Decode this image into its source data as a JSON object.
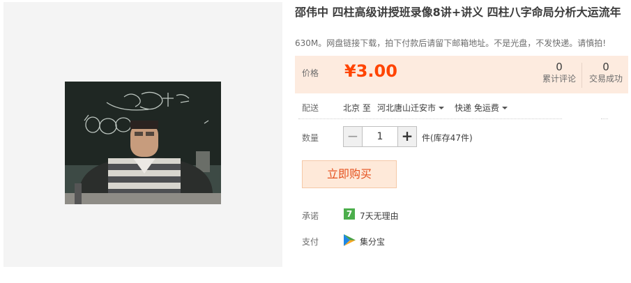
{
  "product": {
    "title": "邵伟中 四柱高级讲授班录像8讲+讲义 四柱八字命局分析大运流年",
    "subtitle": "630M。网盘链接下载，拍下付款后请留下邮箱地址。不是光盘，不发快递。请慎拍!"
  },
  "price_panel": {
    "label": "价格",
    "price": "¥3.00",
    "reviews_count": "0",
    "reviews_label": "累计评论",
    "sales_count": "0",
    "sales_label": "交易成功"
  },
  "shipping": {
    "label": "配送",
    "from": "北京 至",
    "to": "河北唐山迁安市",
    "method": "快递 免运费"
  },
  "quantity": {
    "label": "数量",
    "minus": "−",
    "value": "1",
    "plus": "+",
    "stock": "件(库存47件)"
  },
  "buy_button": "立即购买",
  "promise": {
    "label": "承诺",
    "icon_text": "7",
    "text": "7天无理由"
  },
  "payment": {
    "label": "支付",
    "text": "集分宝"
  },
  "colors": {
    "price": "#ff4400",
    "price_panel_bg": "#fdebdf",
    "buy_button_bg": "#fee9d9",
    "promise_icon": "#4cae4c"
  }
}
